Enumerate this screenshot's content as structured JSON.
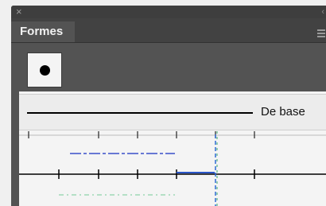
{
  "window": {
    "close_glyph": "×",
    "collapse_glyph": "‹"
  },
  "panel": {
    "tab_label": "Formes",
    "menu_icon": "hamburger-menu-icon"
  },
  "swatch": {
    "selected_shape": "round-brush-dot"
  },
  "brushes": [
    {
      "label": "De base",
      "style": "solid"
    }
  ],
  "colors": {
    "panel_bg": "#535353",
    "tab_bar": "#424242",
    "list_bg": "#f4f4f4"
  }
}
